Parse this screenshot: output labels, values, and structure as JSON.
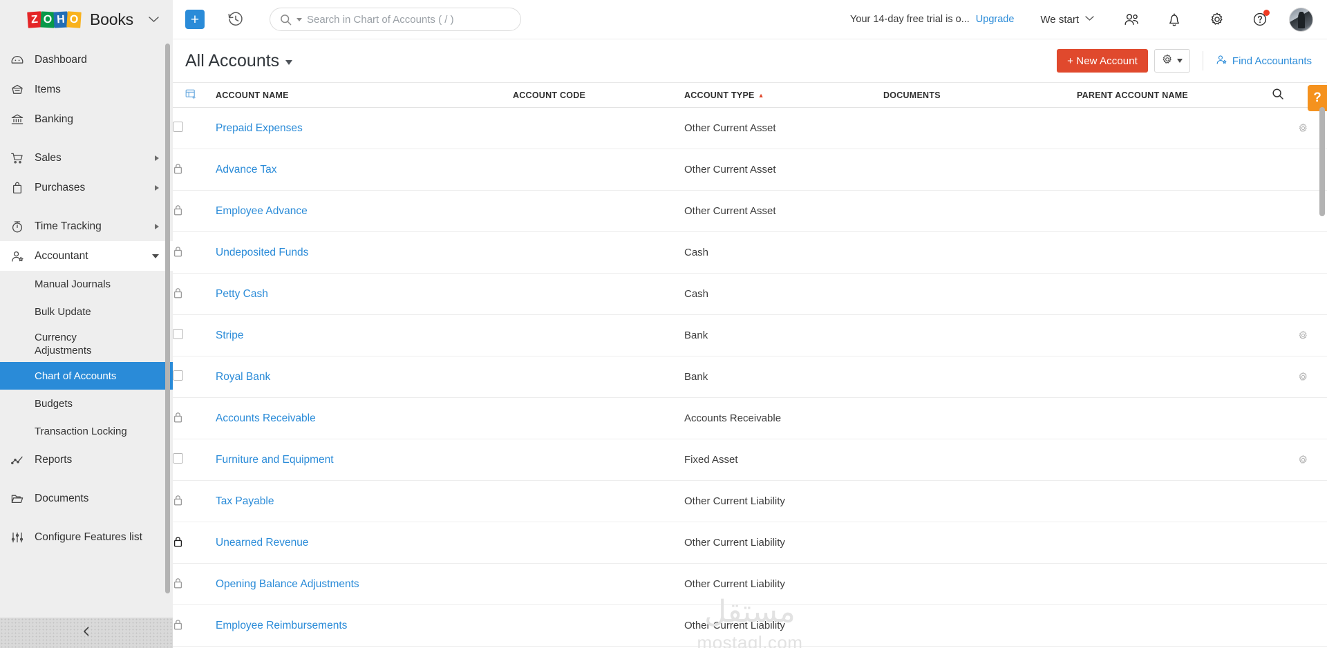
{
  "brand": {
    "logo_letters": [
      "Z",
      "O",
      "H",
      "O"
    ],
    "name": "Books",
    "caret_icon": "chevron-down-icon"
  },
  "topbar": {
    "create_label": "+",
    "history_icon": "history-icon",
    "search": {
      "placeholder": "Search in Chart of Accounts ( / )",
      "value": "",
      "icon": "search-icon"
    },
    "trial_text": "Your 14-day free trial is o...",
    "upgrade_label": "Upgrade",
    "org_name": "We start",
    "icons": [
      {
        "name": "contacts-icon",
        "label": "Contacts"
      },
      {
        "name": "bell-icon",
        "label": "Notifications"
      },
      {
        "name": "gear-icon",
        "label": "Settings"
      },
      {
        "name": "help-icon",
        "label": "Help",
        "badge": true
      }
    ],
    "avatar_label": "User profile"
  },
  "sidebar": {
    "items": [
      {
        "label": "Dashboard",
        "icon": "dashboard-icon",
        "type": "item"
      },
      {
        "label": "Items",
        "icon": "items-icon",
        "type": "item"
      },
      {
        "label": "Banking",
        "icon": "bank-icon",
        "type": "item"
      },
      {
        "label": "Sales",
        "icon": "cart-icon",
        "type": "item",
        "expandable": true
      },
      {
        "label": "Purchases",
        "icon": "bag-icon",
        "type": "item",
        "expandable": true
      },
      {
        "label": "Time Tracking",
        "icon": "timer-icon",
        "type": "item",
        "expandable": true
      },
      {
        "label": "Accountant",
        "icon": "accountant-icon",
        "type": "item",
        "expanded": true
      },
      {
        "label": "Manual Journals",
        "type": "sub"
      },
      {
        "label": "Bulk Update",
        "type": "sub"
      },
      {
        "label": "Currency Adjustments",
        "type": "sub"
      },
      {
        "label": "Chart of Accounts",
        "type": "sub",
        "selected": true
      },
      {
        "label": "Budgets",
        "type": "sub"
      },
      {
        "label": "Transaction Locking",
        "type": "sub"
      },
      {
        "label": "Reports",
        "icon": "reports-icon",
        "type": "item"
      },
      {
        "label": "Documents",
        "icon": "folder-icon",
        "type": "item"
      },
      {
        "label": "Configure Features list",
        "icon": "sliders-icon",
        "type": "item"
      }
    ],
    "collapse_icon": "chevron-left-icon"
  },
  "page": {
    "title": "All Accounts",
    "title_caret": "caret-down-icon",
    "new_account_label": "+ New Account",
    "settings_icon": "gear-icon",
    "find_accountants_label": "Find Accountants",
    "find_accountants_icon": "accountant-icon",
    "help_tab_label": "?"
  },
  "table": {
    "columns": [
      {
        "key": "select",
        "label": "",
        "icon": "column-select-icon"
      },
      {
        "key": "name",
        "label": "ACCOUNT NAME"
      },
      {
        "key": "code",
        "label": "ACCOUNT CODE"
      },
      {
        "key": "type",
        "label": "ACCOUNT TYPE",
        "sorted": true,
        "sort_dir": "asc",
        "accent": "#e0492d"
      },
      {
        "key": "documents",
        "label": "DOCUMENTS"
      },
      {
        "key": "parent",
        "label": "PARENT ACCOUNT NAME"
      },
      {
        "key": "search",
        "label": "",
        "icon": "search-icon"
      }
    ],
    "rows": [
      {
        "selector": "checkbox",
        "name": "Prepaid Expenses",
        "code": "",
        "type": "Other Current Asset",
        "documents": "",
        "parent": "",
        "gear": true
      },
      {
        "selector": "lock",
        "name": "Advance Tax",
        "code": "",
        "type": "Other Current Asset",
        "documents": "",
        "parent": "",
        "gear": false
      },
      {
        "selector": "lock",
        "name": "Employee Advance",
        "code": "",
        "type": "Other Current Asset",
        "documents": "",
        "parent": "",
        "gear": false
      },
      {
        "selector": "lock",
        "name": "Undeposited Funds",
        "code": "",
        "type": "Cash",
        "documents": "",
        "parent": "",
        "gear": false
      },
      {
        "selector": "lock",
        "name": "Petty Cash",
        "code": "",
        "type": "Cash",
        "documents": "",
        "parent": "",
        "gear": false
      },
      {
        "selector": "checkbox",
        "name": "Stripe",
        "code": "",
        "type": "Bank",
        "documents": "",
        "parent": "",
        "gear": true
      },
      {
        "selector": "checkbox",
        "name": "Royal Bank",
        "code": "",
        "type": "Bank",
        "documents": "",
        "parent": "",
        "gear": true
      },
      {
        "selector": "lock",
        "name": "Accounts Receivable",
        "code": "",
        "type": "Accounts Receivable",
        "documents": "",
        "parent": "",
        "gear": false
      },
      {
        "selector": "checkbox",
        "name": "Furniture and Equipment",
        "code": "",
        "type": "Fixed Asset",
        "documents": "",
        "parent": "",
        "gear": true
      },
      {
        "selector": "lock",
        "name": "Tax Payable",
        "code": "",
        "type": "Other Current Liability",
        "documents": "",
        "parent": "",
        "gear": false
      },
      {
        "selector": "lock-bold",
        "name": "Unearned Revenue",
        "code": "",
        "type": "Other Current Liability",
        "documents": "",
        "parent": "",
        "gear": false
      },
      {
        "selector": "lock",
        "name": "Opening Balance Adjustments",
        "code": "",
        "type": "Other Current Liability",
        "documents": "",
        "parent": "",
        "gear": false
      },
      {
        "selector": "lock",
        "name": "Employee Reimbursements",
        "code": "",
        "type": "Other Current Liability",
        "documents": "",
        "parent": "",
        "gear": false
      }
    ]
  },
  "watermark": {
    "arabic": "مستقل",
    "latin": "mostaql.com"
  },
  "colors": {
    "accent_red": "#e0492d",
    "link_blue": "#2a8bd8",
    "sidebar_bg": "#eeeeee",
    "help_orange": "#f5921e"
  }
}
